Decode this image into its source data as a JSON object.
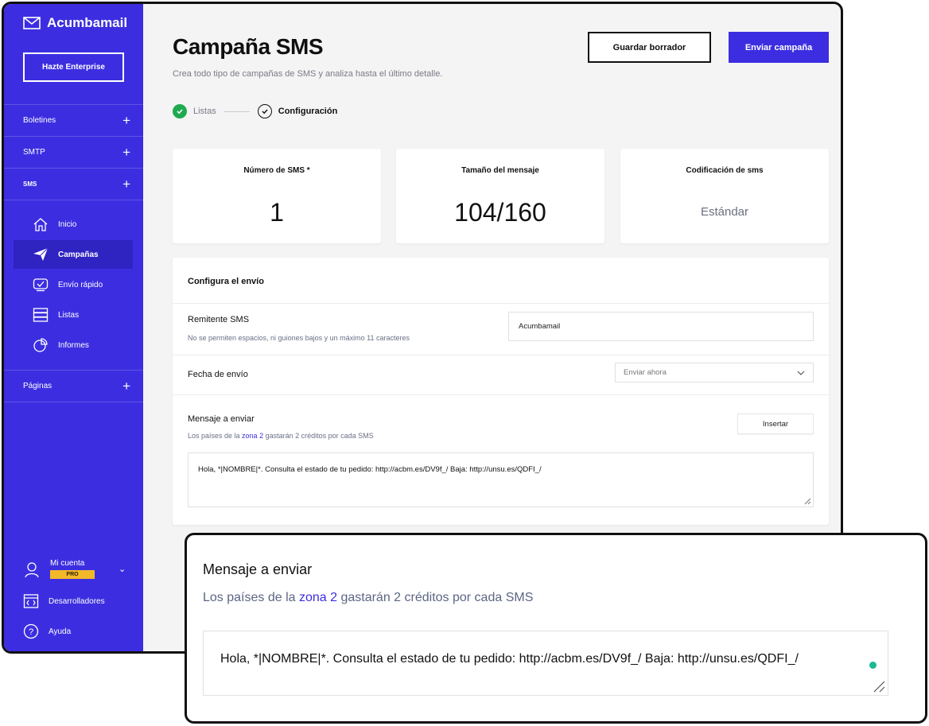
{
  "sidebar": {
    "brand": "Acumbamail",
    "enterprise_button": "Hazte Enterprise",
    "sections": [
      {
        "label": "Boletines"
      },
      {
        "label": "SMTP"
      },
      {
        "label": "SMS"
      }
    ],
    "sms_items": [
      {
        "label": "Inicio",
        "icon": "home-icon"
      },
      {
        "label": "Campañas",
        "icon": "paper-plane-icon",
        "active": true
      },
      {
        "label": "Envío rápido",
        "icon": "quick-send-icon"
      },
      {
        "label": "Listas",
        "icon": "list-icon"
      },
      {
        "label": "Informes",
        "icon": "chart-pie-icon"
      }
    ],
    "pages_section": "Páginas",
    "footer": {
      "account": "Mi cuenta",
      "account_badge": "PRO",
      "developers": "Desarrolladores",
      "help": "Ayuda"
    }
  },
  "header": {
    "title": "Campaña SMS",
    "subtitle": "Crea todo tipo de campañas de SMS y analiza hasta el último detalle.",
    "draft_button": "Guardar borrador",
    "send_button": "Enviar campaña"
  },
  "steps": [
    {
      "label": "Listas",
      "state": "done"
    },
    {
      "label": "Configuración",
      "state": "current"
    }
  ],
  "stats": [
    {
      "label": "Número de SMS *",
      "value": "1"
    },
    {
      "label": "Tamaño del mensaje",
      "value": "104/160"
    },
    {
      "label": "Codificación de sms",
      "value": "Estándar"
    }
  ],
  "config": {
    "title": "Configura el envío",
    "sender_label": "Remitente SMS",
    "sender_hint": "No se permiten espacios, ni guiones bajos y un máximo 11 caracteres",
    "sender_value": "Acumbamail",
    "date_label": "Fecha de envío",
    "date_value": "Enviar ahora",
    "message_label": "Mensaje a enviar",
    "message_hint_pre": "Los países de la ",
    "message_hint_link": "zona 2",
    "message_hint_post": " gastarán 2 créditos por cada SMS",
    "insert_button": "Insertar",
    "message_text": "Hola, *|NOMBRE|*. Consulta el estado de tu pedido: http://acbm.es/DV9f_/ Baja: http://unsu.es/QDFI_/"
  },
  "colors": {
    "brand": "#3c2ee0",
    "success": "#1faa4f",
    "pro_badge": "#f2b829",
    "cursor_dot": "#1bb892"
  }
}
